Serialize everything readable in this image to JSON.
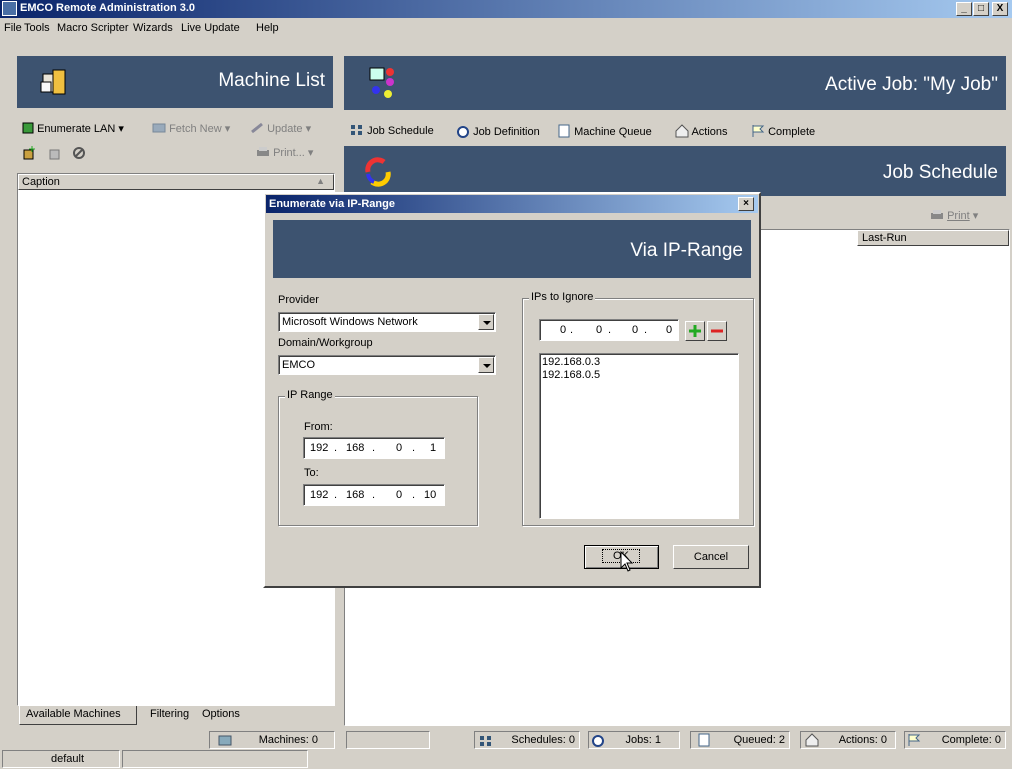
{
  "window": {
    "title": "EMCO Remote Administration 3.0",
    "min": "_",
    "max": "□",
    "close": "X"
  },
  "menu": [
    "File",
    "Tools",
    "Macro Scripter",
    "Wizards",
    "Live Update",
    "Help"
  ],
  "left": {
    "banner_title": "Machine List",
    "toolbar1": {
      "enumerate": "Enumerate LAN",
      "fetch": "Fetch New",
      "update": "Update"
    },
    "toolbar2": {
      "print": "Print..."
    },
    "list_header": "Caption",
    "tabs": [
      "Available Machines",
      "Filtering",
      "Options"
    ],
    "machines_count": "Machines: 0",
    "status_default": "default"
  },
  "right": {
    "active_job": "Active Job: \"My Job\"",
    "tabs": [
      "Job Schedule",
      "Job Definition",
      "Machine Queue",
      "Actions",
      "Complete"
    ],
    "section_title": "Job Schedule",
    "print": "Print",
    "column_lastrun": "Last-Run"
  },
  "dialog": {
    "title": "Enumerate via IP-Range",
    "banner": "Via IP-Range",
    "provider_label": "Provider",
    "provider_value": "Microsoft Windows Network",
    "domain_label": "Domain/Workgroup",
    "domain_value": "EMCO",
    "ip_range_label": "IP Range",
    "from_label": "From:",
    "from_ip": [
      "192",
      "168",
      "0",
      "1"
    ],
    "to_label": "To:",
    "to_ip": [
      "192",
      "168",
      "0",
      "10"
    ],
    "ignore_label": "IPs to Ignore",
    "ignore_ip": [
      "0",
      "0",
      "0",
      "0"
    ],
    "ignore_list": [
      "192.168.0.3",
      "192.168.0.5"
    ],
    "ok": "OK",
    "cancel": "Cancel"
  },
  "status": {
    "schedules": "Schedules: 0",
    "jobs": "Jobs: 1",
    "queued": "Queued: 2",
    "actions": "Actions: 0",
    "complete": "Complete: 0"
  },
  "colors": {
    "banner": "#3d5370",
    "titlebar": "#0a246a",
    "face": "#d4d0c8"
  }
}
